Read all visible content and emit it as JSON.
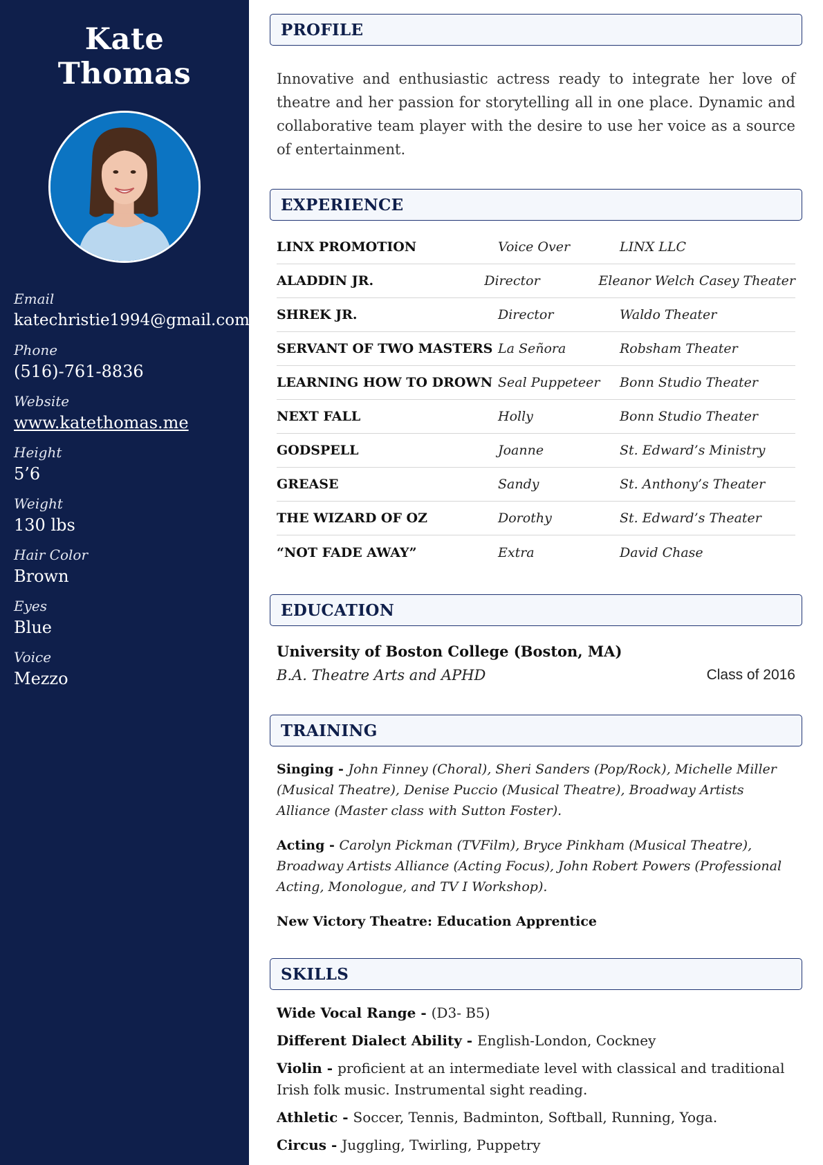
{
  "sidebar": {
    "name": "Kate Thomas",
    "fields": [
      {
        "label": "Email",
        "value": "katechristie1994@gmail.com"
      },
      {
        "label": "Phone",
        "value": "(516)-761-8836"
      },
      {
        "label": "Website",
        "value": "www.katethomas.me"
      },
      {
        "label": "Height",
        "value": "5’6"
      },
      {
        "label": "Weight",
        "value": "130 lbs"
      },
      {
        "label": "Hair Color",
        "value": "Brown"
      },
      {
        "label": "Eyes",
        "value": "Blue"
      },
      {
        "label": "Voice",
        "value": "Mezzo"
      }
    ]
  },
  "profile": {
    "heading": "PROFILE",
    "text": "Innovative and enthusiastic actress ready to integrate her love of theatre and her passion for storytelling all in one place. Dynamic and collaborative team player with the desire to use her voice as a source of entertainment."
  },
  "experience": {
    "heading": "EXPERIENCE",
    "rows": [
      {
        "title": "LINX PROMOTION",
        "role": "Voice Over",
        "venue": "LINX LLC"
      },
      {
        "title": "ALADDIN JR.",
        "role": "Director",
        "venue": "Eleanor Welch Casey Theater"
      },
      {
        "title": "SHREK JR.",
        "role": "Director",
        "venue": "Waldo Theater"
      },
      {
        "title": "SERVANT OF TWO MASTERS",
        "role": "La Señora",
        "venue": "Robsham Theater"
      },
      {
        "title": "LEARNING HOW TO DROWN",
        "role": "Seal Puppeteer",
        "venue": "Bonn Studio Theater"
      },
      {
        "title": "NEXT FALL",
        "role": "Holly",
        "venue": "Bonn Studio Theater"
      },
      {
        "title": "GODSPELL",
        "role": "Joanne",
        "venue": "St. Edward’s Ministry"
      },
      {
        "title": "GREASE",
        "role": "Sandy",
        "venue": "St. Anthony’s Theater"
      },
      {
        "title": "THE WIZARD OF OZ",
        "role": "Dorothy",
        "venue": "St. Edward’s Theater"
      },
      {
        "title": "“NOT FADE AWAY”",
        "role": "Extra",
        "venue": "David Chase"
      }
    ]
  },
  "education": {
    "heading": "EDUCATION",
    "school": "University of Boston College (Boston, MA)",
    "degree": "B.A. Theatre Arts and APHD",
    "class_of": "Class of 2016"
  },
  "training": {
    "heading": "TRAINING",
    "items": [
      {
        "label": "Singing - ",
        "text": "John Finney (Choral), Sheri Sanders (Pop/Rock), Michelle Miller (Musical Theatre), Denise Puccio (Musical Theatre), Broadway Artists Alliance (Master class with Sutton Foster)."
      },
      {
        "label": "Acting - ",
        "text": "Carolyn Pickman (TVFilm), Bryce Pinkham (Musical Theatre), Broadway Artists Alliance  (Acting Focus), John Robert Powers (Professional Acting, Monologue, and TV I Workshop)."
      },
      {
        "label": "New Victory Theatre: Education Apprentice",
        "text": ""
      }
    ]
  },
  "skills": {
    "heading": "SKILLS",
    "items": [
      {
        "label": "Wide Vocal Range - ",
        "text": "(D3- B5)"
      },
      {
        "label": "Different Dialect Ability - ",
        "text": "English-London, Cockney"
      },
      {
        "label": "Violin - ",
        "text": "proficient at an intermediate level with classical and traditional Irish folk music. Instrumental sight reading."
      },
      {
        "label": "Athletic - ",
        "text": "Soccer, Tennis, Badminton, Softball, Running, Yoga."
      },
      {
        "label": "Circus - ",
        "text": "Juggling, Twirling, Puppetry"
      }
    ]
  },
  "colors": {
    "sidebar_bg": "#0f1f4b",
    "heading_border": "#1f3473",
    "heading_bg": "#f4f7fc",
    "photo_bg": "#0c74c2"
  }
}
